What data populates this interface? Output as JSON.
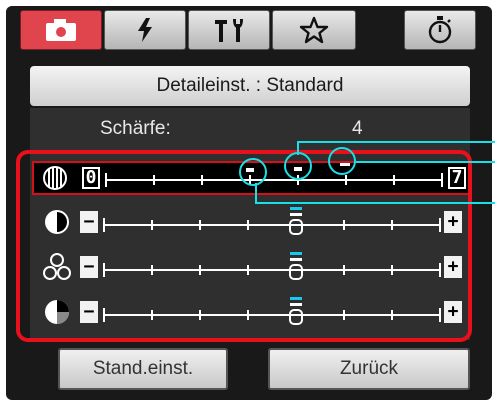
{
  "tabs": [
    {
      "name": "camera-icon",
      "active": true
    },
    {
      "name": "flash-icon",
      "active": false
    },
    {
      "name": "tools-icon",
      "active": false
    },
    {
      "name": "star-icon",
      "active": false
    }
  ],
  "timer_tab": {
    "icon": "stopwatch-icon"
  },
  "header": {
    "title": "Detaileinst. : Standard"
  },
  "sharpness": {
    "label": "Schärfe:",
    "value": "4"
  },
  "sliders": [
    {
      "icon": "sharpness-icon",
      "min_label": "0",
      "max_label": "7",
      "selected": true,
      "value": 4,
      "default": 3
    },
    {
      "icon": "contrast-icon",
      "min_label": "−",
      "max_label": "+",
      "selected": false,
      "value": 0
    },
    {
      "icon": "saturation-icon",
      "min_label": "−",
      "max_label": "+",
      "selected": false,
      "value": 0
    },
    {
      "icon": "color-tone-icon",
      "min_label": "−",
      "max_label": "+",
      "selected": false,
      "value": 0
    }
  ],
  "buttons": {
    "default_label": "Stand.einst.",
    "back_label": "Zurück"
  },
  "colors": {
    "accent": "#e0444c",
    "highlight": "#18e0e8",
    "frame": "#e8101a"
  }
}
